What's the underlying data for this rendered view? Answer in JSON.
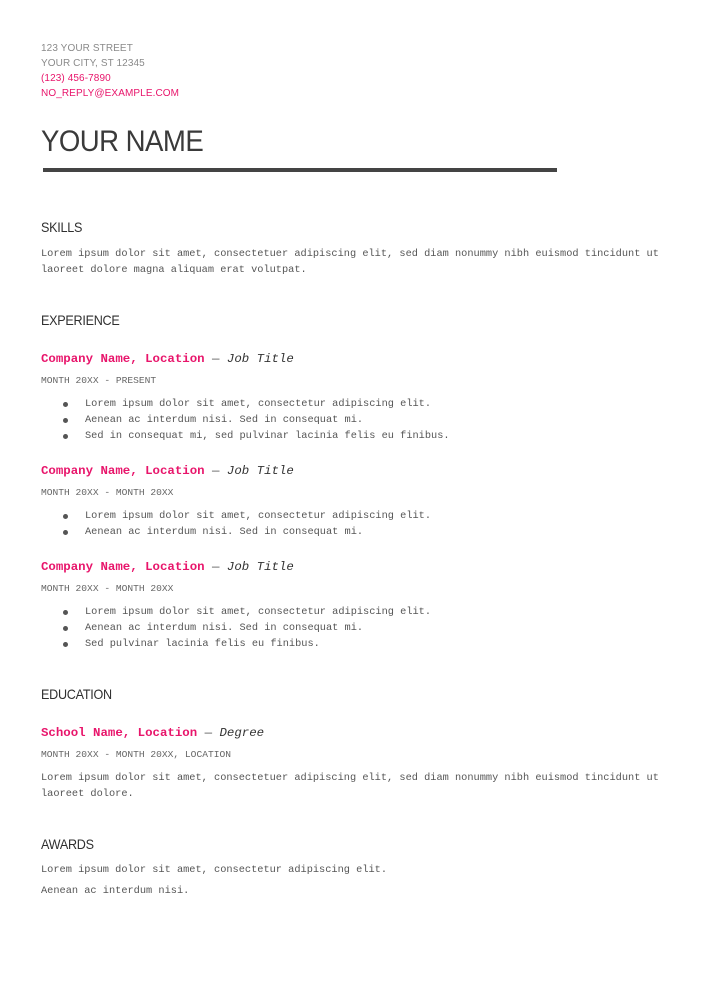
{
  "contact": {
    "street": "123 YOUR STREET",
    "city": "YOUR CITY, ST 12345",
    "phone": "(123) 456-7890",
    "email": "NO_REPLY@EXAMPLE.COM"
  },
  "name": "YOUR NAME",
  "colors": {
    "accent": "#e8156b",
    "rule": "#444444",
    "text": "#555555"
  },
  "skills": {
    "heading": "SKILLS",
    "text": "Lorem ipsum dolor sit amet, consectetuer adipiscing elit, sed diam nonummy nibh euismod tincidunt ut laoreet dolore magna aliquam erat volutpat."
  },
  "experience": {
    "heading": "EXPERIENCE",
    "jobs": [
      {
        "company": "Company Name, Location",
        "dash": " — ",
        "title": "Job Title",
        "dates": "MONTH 20XX - PRESENT",
        "bullets": [
          "Lorem ipsum dolor sit amet, consectetur adipiscing elit.",
          "Aenean ac interdum nisi. Sed in consequat mi.",
          "Sed in consequat mi, sed pulvinar lacinia felis eu finibus."
        ]
      },
      {
        "company": "Company Name, Location",
        "dash": " — ",
        "title": "Job Title",
        "dates": "MONTH 20XX - MONTH 20XX",
        "bullets": [
          "Lorem ipsum dolor sit amet, consectetur adipiscing elit.",
          "Aenean ac interdum nisi. Sed in consequat mi."
        ]
      },
      {
        "company": "Company Name, Location",
        "dash": " — ",
        "title": "Job Title",
        "dates": "MONTH 20XX - MONTH 20XX",
        "bullets": [
          "Lorem ipsum dolor sit amet, consectetur adipiscing elit.",
          "Aenean ac interdum nisi. Sed in consequat mi.",
          "Sed pulvinar lacinia felis eu finibus."
        ]
      }
    ]
  },
  "education": {
    "heading": "EDUCATION",
    "school": "School Name, Location",
    "dash": " — ",
    "degree": "Degree",
    "dates": "MONTH 20XX - MONTH 20XX, LOCATION",
    "text": "Lorem ipsum dolor sit amet, consectetuer adipiscing elit, sed diam nonummy nibh euismod tincidunt ut laoreet dolore."
  },
  "awards": {
    "heading": "AWARDS",
    "items": [
      "Lorem ipsum dolor sit amet, consectetur adipiscing elit.",
      "Aenean ac interdum nisi."
    ]
  }
}
